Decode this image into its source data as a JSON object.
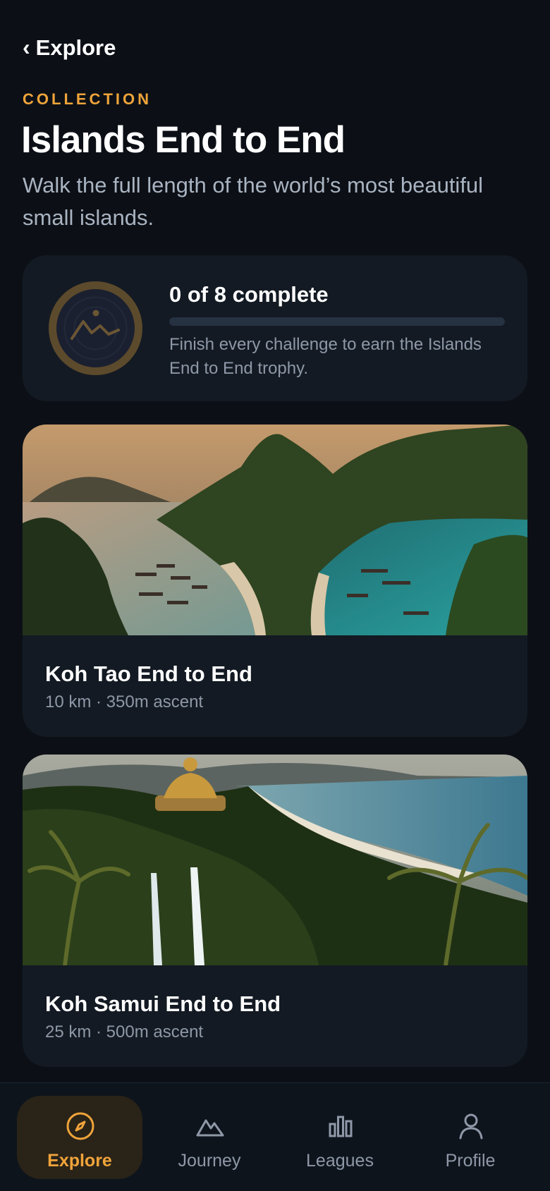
{
  "nav": {
    "back_label": "Explore"
  },
  "header": {
    "eyebrow": "COLLECTION",
    "title": "Islands End to End",
    "subtitle": "Walk the full length of the world’s most beautiful small islands."
  },
  "progress": {
    "completed": 0,
    "total": 8,
    "count_text": "0 of 8 complete",
    "description": "Finish every challenge to earn the Islands End to End trophy."
  },
  "challenges": [
    {
      "title": "Koh Tao End to End",
      "meta": "10 km · 350m ascent"
    },
    {
      "title": "Koh Samui End to End",
      "meta": "25 km · 500m ascent"
    }
  ],
  "tabs": [
    {
      "label": "Explore",
      "icon": "compass-icon",
      "active": true
    },
    {
      "label": "Journey",
      "icon": "mountain-icon",
      "active": false
    },
    {
      "label": "Leagues",
      "icon": "bar-chart-icon",
      "active": false
    },
    {
      "label": "Profile",
      "icon": "person-icon",
      "active": false
    }
  ],
  "colors": {
    "background": "#0c1016",
    "card": "#131a23",
    "accent": "#f0a43a",
    "muted_text": "#8e98a7"
  }
}
